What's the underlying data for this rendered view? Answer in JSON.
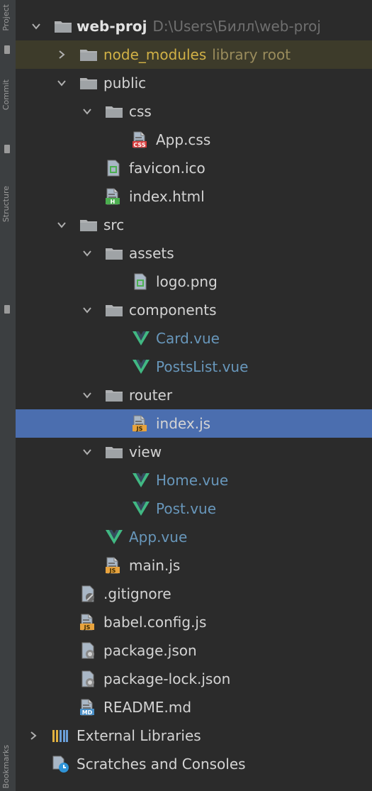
{
  "sidebar": {
    "labels": [
      "Project",
      "Commit",
      "Structure",
      "Bookmarks"
    ]
  },
  "tree": [
    {
      "id": "web-proj",
      "label": "web-proj",
      "sublabel": "D:\\Users\\Билл\\web-proj",
      "icon": "folder-icon",
      "expanded": true,
      "bold": true
    },
    {
      "id": "node-modules",
      "label": "node_modules",
      "sublabel": "library root",
      "icon": "folder-icon",
      "expanded": false,
      "highlighted": true
    },
    {
      "id": "public",
      "label": "public",
      "icon": "folder-icon",
      "expanded": true
    },
    {
      "id": "css",
      "label": "css",
      "icon": "folder-icon",
      "expanded": true
    },
    {
      "id": "app-css",
      "label": "App.css",
      "icon": "css-file-icon",
      "color": "#6897bb"
    },
    {
      "id": "favicon",
      "label": "favicon.ico",
      "icon": "image-file-icon"
    },
    {
      "id": "index-html",
      "label": "index.html",
      "icon": "html-file-icon"
    },
    {
      "id": "src",
      "label": "src",
      "icon": "folder-icon",
      "expanded": true
    },
    {
      "id": "assets",
      "label": "assets",
      "icon": "folder-icon",
      "expanded": true
    },
    {
      "id": "logo",
      "label": "logo.png",
      "icon": "image-file-icon"
    },
    {
      "id": "components",
      "label": "components",
      "icon": "folder-icon",
      "expanded": true
    },
    {
      "id": "card-vue",
      "label": "Card.vue",
      "icon": "vue-file-icon"
    },
    {
      "id": "postslist-vue",
      "label": "PostsList.vue",
      "icon": "vue-file-icon"
    },
    {
      "id": "router",
      "label": "router",
      "icon": "folder-icon",
      "expanded": true
    },
    {
      "id": "router-index",
      "label": "index.js",
      "icon": "js-file-icon",
      "selected": true
    },
    {
      "id": "view",
      "label": "view",
      "icon": "folder-icon",
      "expanded": true
    },
    {
      "id": "home-vue",
      "label": "Home.vue",
      "icon": "vue-file-icon"
    },
    {
      "id": "post-vue",
      "label": "Post.vue",
      "icon": "vue-file-icon"
    },
    {
      "id": "app-vue",
      "label": "App.vue",
      "icon": "vue-file-icon"
    },
    {
      "id": "main-js",
      "label": "main.js",
      "icon": "js-file-icon"
    },
    {
      "id": "gitignore",
      "label": ".gitignore",
      "icon": "ignore-file-icon"
    },
    {
      "id": "babel-config",
      "label": "babel.config.js",
      "icon": "js-file-icon"
    },
    {
      "id": "package-json",
      "label": "package.json",
      "icon": "json-file-icon"
    },
    {
      "id": "package-lock",
      "label": "package-lock.json",
      "icon": "json-file-icon"
    },
    {
      "id": "readme",
      "label": "README.md",
      "icon": "md-file-icon"
    },
    {
      "id": "external-libraries",
      "label": "External Libraries",
      "icon": "libraries-icon",
      "expanded": false
    },
    {
      "id": "scratches",
      "label": "Scratches and Consoles",
      "icon": "scratches-icon"
    }
  ],
  "colors": {
    "background": "#2b2b2b",
    "selection": "#4b6eaf",
    "library_root_highlight": "#3d3b2a",
    "vue_text": "#6897bb",
    "node_modules_text": "#d1b146"
  }
}
